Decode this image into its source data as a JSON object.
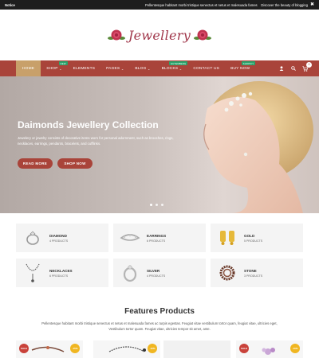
{
  "topbar": {
    "notice": "Notice",
    "ticker": "Pellentesque habitant morbi tristique senectus et netus et malesuada fames",
    "tagline": "Discover the beauty of blogging"
  },
  "logo": {
    "text": "Jewellery"
  },
  "nav": {
    "items": [
      {
        "label": "Home",
        "caret": ""
      },
      {
        "label": "Shop",
        "caret": "⌄",
        "badge": "NEW"
      },
      {
        "label": "Elements",
        "caret": ""
      },
      {
        "label": "Pages",
        "caret": "⌄"
      },
      {
        "label": "Blog",
        "caret": "⌄"
      },
      {
        "label": "Blocks",
        "caret": "⌄",
        "badge": "GUTENBERG"
      },
      {
        "label": "Contact Us",
        "caret": ""
      },
      {
        "label": "Buy Now",
        "caret": "",
        "badge": "SHOPIFY"
      }
    ],
    "cart_count": "0",
    "icons": [
      "user-icon",
      "search-icon",
      "cart-icon"
    ]
  },
  "hero": {
    "title": "Daimonds Jewellery Collection",
    "description": "Jewelery or jewelry consists of decorative items worn for personal adornment, such as brooches, rings, necklaces, earrings, pendants, bracelets, and cufflinks.",
    "read_more": "READ MORE",
    "shop_now": "SHOP NOW"
  },
  "categories": [
    {
      "name": "Diamond",
      "count": "4 PRODUCTS",
      "icon": "ring-icon"
    },
    {
      "name": "Earrings",
      "count": "6 PRODUCTS",
      "icon": "bracelet-icon"
    },
    {
      "name": "Gold",
      "count": "5 PRODUCTS",
      "icon": "earrings-icon"
    },
    {
      "name": "Necklaces",
      "count": "6 PRODUCTS",
      "icon": "necklace-icon"
    },
    {
      "name": "Silver",
      "count": "4 PRODUCTS",
      "icon": "silver-bangle-icon"
    },
    {
      "name": "Stone",
      "count": "3 PRODUCTS",
      "icon": "stone-bracelet-icon"
    }
  ],
  "features": {
    "title": "Features Products",
    "description": "Pellentesque habitant morbi tristique senectus et netus et malesuada fames ac turpis egestas. Feugiat vitae vestibulum tortor quam, feugiat vitae, ultricies eget, Vestibulum tortor quam. Feugiat vitae, ultricies tempor sit amet, ante."
  },
  "products": [
    {
      "sale": "SALE",
      "off": "-15%"
    },
    {
      "sale": "",
      "off": "-10%"
    },
    {
      "sale": "",
      "off": ""
    },
    {
      "sale": "SALE",
      "off": "-10%"
    }
  ],
  "colors": {
    "accent": "#a9443a",
    "nav_active": "#c8a06a",
    "sale_badge": "#c9423a",
    "discount_badge": "#f0b621"
  }
}
